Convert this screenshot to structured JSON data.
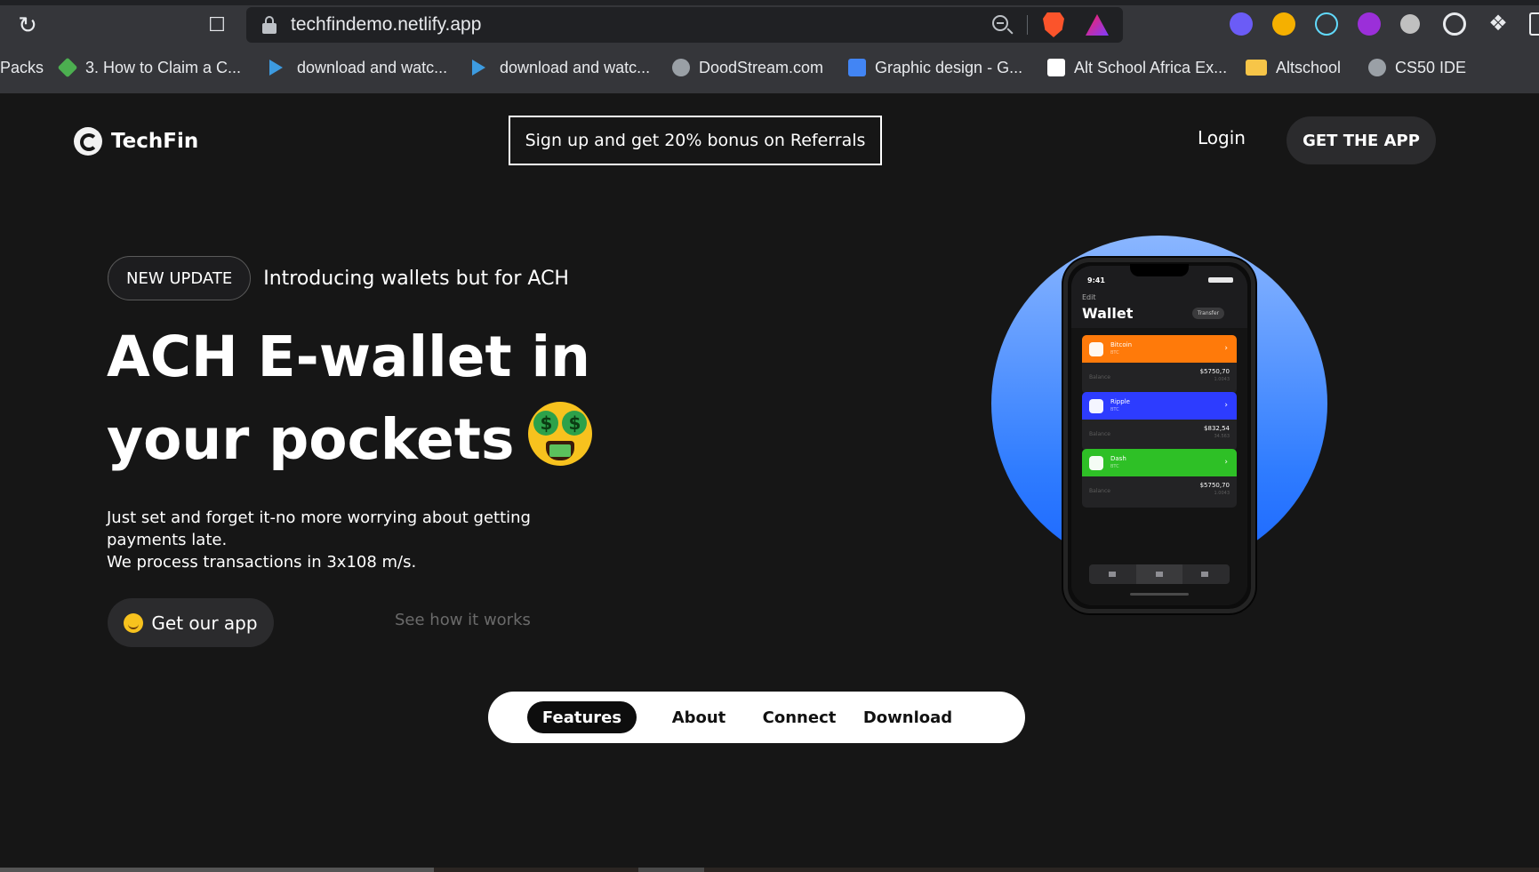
{
  "browser": {
    "url": "techfindemo.netlify.app",
    "bookmarks": [
      "Packs",
      "3. How to Claim a C...",
      "download and watc...",
      "download and watc...",
      "DoodStream.com",
      "Graphic design - G...",
      "Alt School Africa Ex...",
      "Altschool",
      "CS50 IDE"
    ]
  },
  "header": {
    "logo_text": "TechFin",
    "promo": "Sign up and get 20% bonus on Referrals",
    "login": "Login",
    "get_app": "GET THE APP"
  },
  "hero": {
    "badge": "NEW UPDATE",
    "badge_text": "Introducing wallets but for ACH",
    "title_line1": "ACH E-wallet in",
    "title_line2": "your pockets",
    "desc_line1": "Just set and forget it-no more worrying about getting",
    "desc_line2": "payments late.",
    "desc_line3": "We process transactions in 3x108 m/s.",
    "cta": "Get our app",
    "secondary": "See how it works"
  },
  "phone": {
    "time": "9:41",
    "edit": "Edit",
    "title": "Wallet",
    "transfer": "Transfer",
    "balance_label": "Balance",
    "cards": [
      {
        "name": "Bitcoin",
        "symbol": "BTC",
        "balance": "$5750,70",
        "sub": "1.0043",
        "color": "#ff7a0a"
      },
      {
        "name": "Ripple",
        "symbol": "BTC",
        "balance": "$832,54",
        "sub": "34.563",
        "color": "#2d3cff"
      },
      {
        "name": "Dash",
        "symbol": "BTC",
        "balance": "$5750,70",
        "sub": "1.0043",
        "color": "#2ec026"
      }
    ]
  },
  "bottom_nav": {
    "items": [
      "Features",
      "About",
      "Connect",
      "Download"
    ],
    "active": "Features"
  }
}
